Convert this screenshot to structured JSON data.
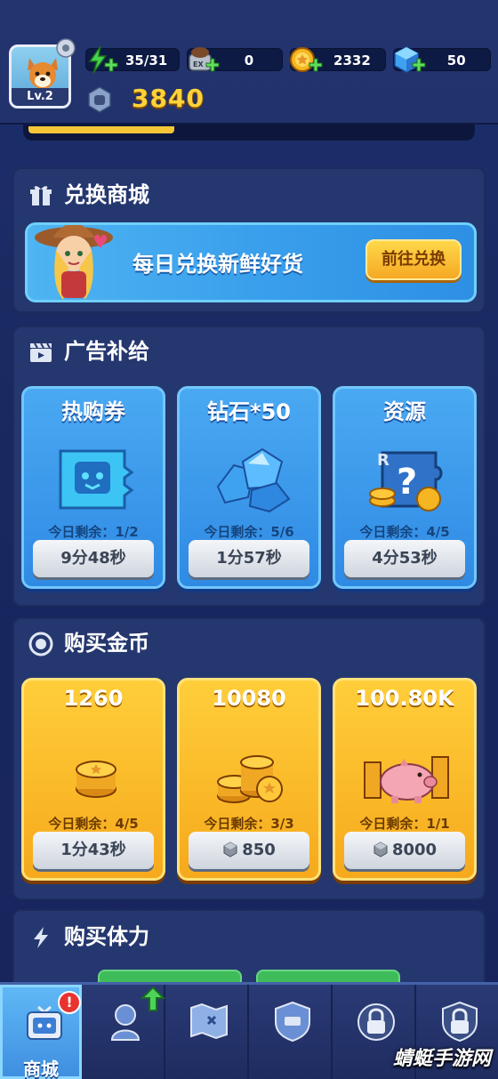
{
  "header": {
    "level": "Lv.2",
    "stamina": "35/31",
    "exp_items": "0",
    "coins": "2332",
    "gems": "50",
    "power": "3840"
  },
  "exchange": {
    "title": "兑换商城",
    "banner_text": "每日兑换新鲜好货",
    "button": "前往兑换"
  },
  "ads": {
    "title": "广告补给",
    "cards": [
      {
        "title": "热购券",
        "remain": "今日剩余：1/2",
        "button": "9分48秒"
      },
      {
        "title": "钻石*50",
        "remain": "今日剩余：5/6",
        "button": "1分57秒"
      },
      {
        "title": "资源",
        "remain": "今日剩余：4/5",
        "button": "4分53秒"
      }
    ]
  },
  "coins_shop": {
    "title": "购买金币",
    "cards": [
      {
        "title": "1260",
        "remain": "今日剩余：4/5",
        "button": "1分43秒"
      },
      {
        "title": "10080",
        "remain": "今日剩余：3/3",
        "button": "850"
      },
      {
        "title": "100.80K",
        "remain": "今日剩余：1/1",
        "button": "8000"
      }
    ]
  },
  "stamina_shop": {
    "title": "购买体力"
  },
  "nav": {
    "shop_label": "商城",
    "badge": "!"
  },
  "watermark": "蜻蜓手游网",
  "colors": {
    "background": "#1a2a62",
    "panel": "#25376f",
    "card_blue": "#3a98ea",
    "card_gold": "#f9bb2b",
    "power_text": "#ffd23b"
  }
}
